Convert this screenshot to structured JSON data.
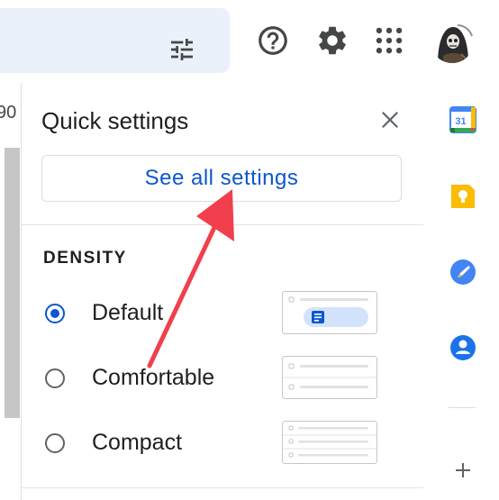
{
  "topbar": {
    "search_options_icon": "tune-icon",
    "help_icon": "help-icon",
    "settings_icon": "gear-icon",
    "apps_icon": "apps-grid-icon",
    "avatar_icon": "account-avatar"
  },
  "left_strip": {
    "partial_text": "90"
  },
  "quick_settings": {
    "title": "Quick settings",
    "close_icon": "close-icon",
    "see_all_label": "See all settings",
    "density": {
      "heading": "DENSITY",
      "options": [
        {
          "label": "Default",
          "selected": true
        },
        {
          "label": "Comfortable",
          "selected": false
        },
        {
          "label": "Compact",
          "selected": false
        }
      ]
    }
  },
  "right_rail": {
    "calendar_date": "31",
    "icons": [
      "calendar-icon",
      "keep-icon",
      "tasks-icon",
      "contacts-icon",
      "add-icon"
    ]
  },
  "colors": {
    "accent_blue": "#0b57d0",
    "search_bg": "#eaf1fb",
    "annotation_arrow": "#f1404b"
  }
}
